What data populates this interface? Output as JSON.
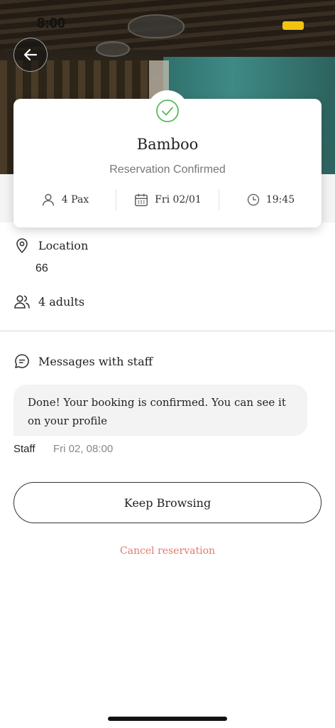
{
  "status_bar": {
    "time": "8:00"
  },
  "hero": {
    "image": "restaurant-interior-photo"
  },
  "back_button": {
    "icon": "arrow-left-icon"
  },
  "reservation_card": {
    "title": "Bamboo",
    "status": "Reservation Confirmed",
    "status_icon": "check-circle-icon",
    "pax": "4 Pax",
    "date": "Fri 02/01",
    "time": "19:45",
    "accent_color": "#5cb85c"
  },
  "details": {
    "location_label": "Location",
    "location_value": "66",
    "guests": "4 adults"
  },
  "messages": {
    "heading": "Messages with staff",
    "items": [
      {
        "text": "Done! Your booking is confirmed. You can see it on your profile",
        "sender": "Staff",
        "timestamp": "Fri 02, 08:00"
      }
    ]
  },
  "actions": {
    "keep_browsing": "Keep Browsing",
    "cancel": "Cancel reservation",
    "cancel_color": "#e07a6c"
  }
}
